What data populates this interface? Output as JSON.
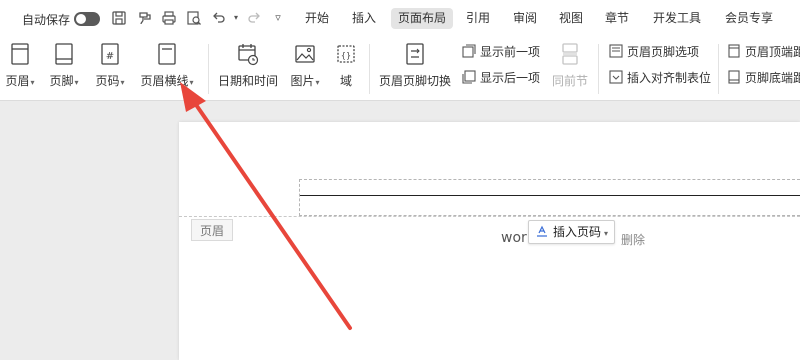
{
  "menubar": {
    "autosave_label": "自动保存",
    "quick_icons": [
      "save-icon",
      "format-painter-icon",
      "print-icon",
      "print-preview-icon",
      "undo-icon",
      "redo-icon",
      "more-icon"
    ],
    "tabs": [
      {
        "label": "开始",
        "active": false
      },
      {
        "label": "插入",
        "active": false
      },
      {
        "label": "页面布局",
        "active": true
      },
      {
        "label": "引用",
        "active": false
      },
      {
        "label": "审阅",
        "active": false
      },
      {
        "label": "视图",
        "active": false
      },
      {
        "label": "章节",
        "active": false
      },
      {
        "label": "开发工具",
        "active": false
      },
      {
        "label": "会员专享",
        "active": false
      }
    ]
  },
  "ribbon": {
    "header": "页眉",
    "footer": "页脚",
    "page_number": "页码",
    "header_line": "页眉横线",
    "date_time": "日期和时间",
    "picture": "图片",
    "field": "域",
    "switch_header_footer": "页眉页脚切换",
    "show_previous": "显示前一项",
    "show_next": "显示后一项",
    "same_as_previous": "同前节",
    "header_footer_options": "页眉页脚选项",
    "insert_align_tab": "插入对齐制表位",
    "header_top_margin": "页眉顶端距",
    "footer_bottom_margin": "页脚底端距"
  },
  "document": {
    "header_tag": "页眉",
    "body_text": "wor",
    "insert_page_number": "插入页码",
    "delete": "删除"
  },
  "colors": {
    "arrow": "#e8463b",
    "active_tab_bg": "#e4e4e4",
    "toggle": "#5a5a5a"
  }
}
